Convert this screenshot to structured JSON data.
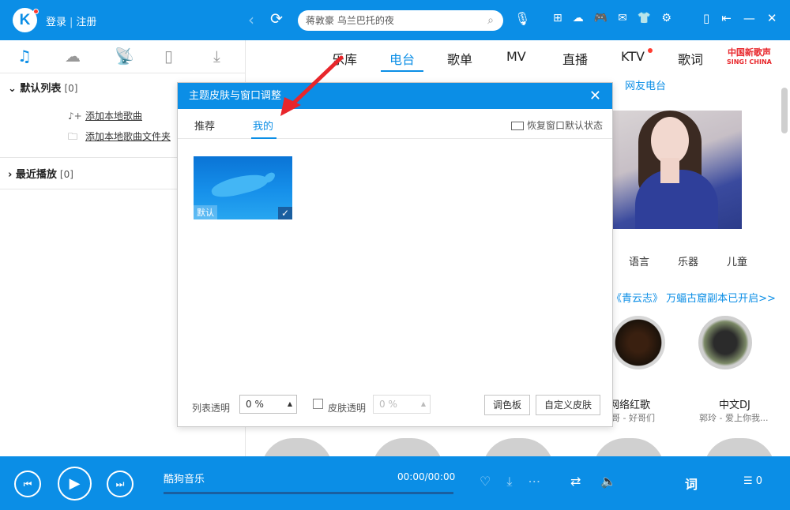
{
  "app": {
    "logo_letter": "K",
    "login": "登录",
    "register": "注册",
    "search_placeholder": "蒋敦豪 乌兰巴托的夜"
  },
  "left": {
    "default_list": "默认列表",
    "default_count": "[0]",
    "add_song": "添加本地歌曲",
    "add_folder": "添加本地歌曲文件夹",
    "recent": "最近播放",
    "recent_count": "[0]"
  },
  "nav": {
    "tabs": [
      "乐库",
      "电台",
      "歌单",
      "MV",
      "直播",
      "KTV",
      "歌词"
    ],
    "brand": "中国新歌声",
    "brand_sub": "SING! CHINA",
    "subtab": "网友电台"
  },
  "right": {
    "categories": [
      "语言",
      "乐器",
      "儿童"
    ],
    "promo": "《青云志》 万蝠古窟副本已开启>>",
    "card1_title": "网络红歌",
    "card1_sub": "哥 - 好哥们",
    "card2_title": "中文DJ",
    "card2_sub": "郭玲 - 爱上你我..."
  },
  "dialog": {
    "title": "主题皮肤与窗口调整",
    "tab_recommend": "推荐",
    "tab_mine": "我的",
    "restore": "恢复窗口默认状态",
    "skin_label": "默认",
    "list_transparency_label": "列表透明",
    "list_transparency_value": "0 %",
    "skin_transparency_label": "皮肤透明",
    "skin_transparency_value": "0 %",
    "palette_button": "调色板",
    "custom_skin_button": "自定义皮肤"
  },
  "player": {
    "track": "酷狗音乐",
    "time": "00:00/00:00",
    "lyric": "词",
    "queue_count": "0"
  },
  "colors": {
    "primary": "#0b8ee6",
    "brand_red": "#e8262b"
  }
}
